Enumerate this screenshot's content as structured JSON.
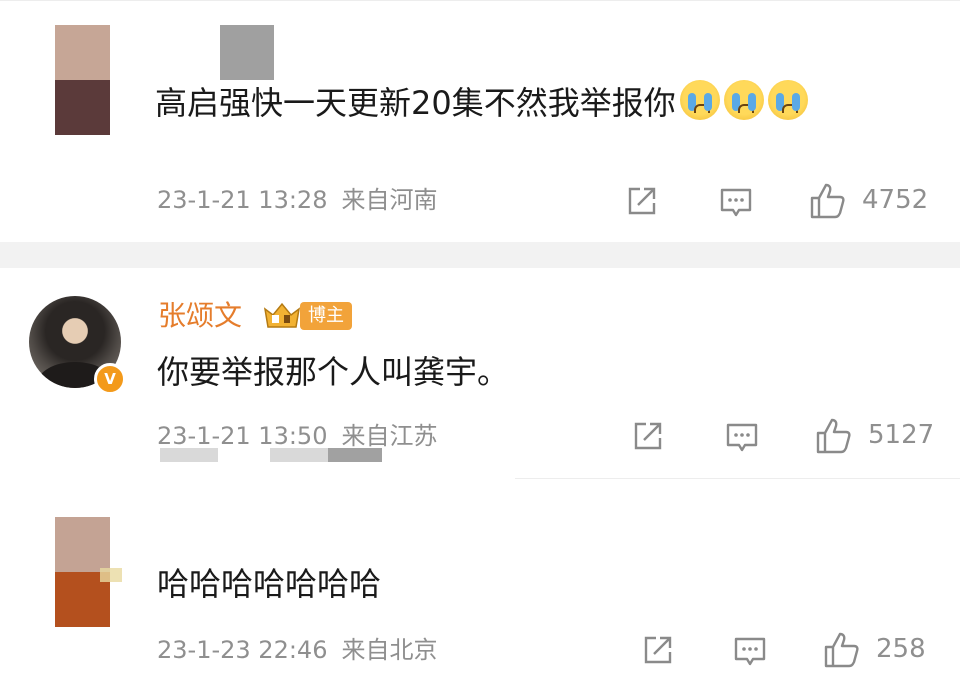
{
  "comments": [
    {
      "text": "高启强快一天更新20集不然我举报你",
      "emojis": [
        "crying-emoji",
        "crying-emoji",
        "crying-emoji"
      ],
      "timestamp": "23-1-21 13:28",
      "location": "来自河南",
      "likes": "4752"
    },
    {
      "username": "张颂文",
      "badge": "博主",
      "verified_mark": "V",
      "text": "你要举报那个人叫龚宇。",
      "timestamp": "23-1-21 13:50",
      "location": "来自江苏",
      "likes": "5127"
    },
    {
      "text": "哈哈哈哈哈哈哈",
      "timestamp": "23-1-23 22:46",
      "location": "来自北京",
      "likes": "258"
    }
  ],
  "icons": {
    "share": "share-icon",
    "comment": "comment-icon",
    "like": "thumbs-up-icon",
    "crown": "crown-icon"
  },
  "colors": {
    "username": "#e57d2c",
    "badge": "#f2a33a",
    "meta": "#8f8f8f",
    "divider": "#f2f2f2"
  }
}
